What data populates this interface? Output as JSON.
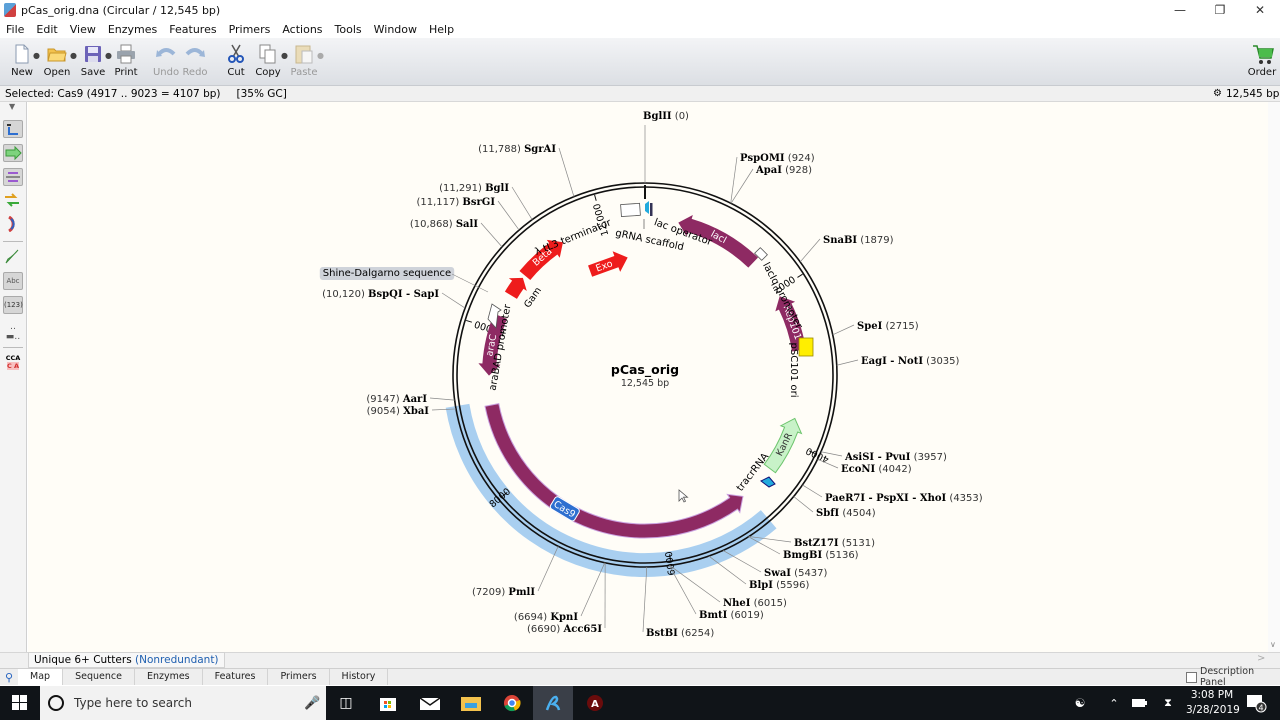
{
  "window": {
    "title": "pCas_orig.dna  (Circular / 12,545 bp)",
    "controls": [
      "minimize",
      "restore",
      "close"
    ]
  },
  "menu": [
    "File",
    "Edit",
    "View",
    "Enzymes",
    "Features",
    "Primers",
    "Actions",
    "Tools",
    "Window",
    "Help"
  ],
  "toolbar": {
    "buttons": [
      {
        "label": "New",
        "icon": "new-file-icon",
        "enabled": true,
        "dropdown": true
      },
      {
        "label": "Open",
        "icon": "folder-open-icon",
        "enabled": true,
        "dropdown": true
      },
      {
        "label": "Save",
        "icon": "save-icon",
        "enabled": true,
        "dropdown": true
      },
      {
        "label": "Print",
        "icon": "print-icon",
        "enabled": true,
        "dropdown": false
      },
      {
        "label": "Undo",
        "icon": "undo-icon",
        "enabled": false,
        "dropdown": false
      },
      {
        "label": "Redo",
        "icon": "redo-icon",
        "enabled": false,
        "dropdown": false
      },
      {
        "label": "Cut",
        "icon": "scissors-icon",
        "enabled": true,
        "dropdown": false
      },
      {
        "label": "Copy",
        "icon": "copy-icon",
        "enabled": true,
        "dropdown": true
      },
      {
        "label": "Paste",
        "icon": "paste-icon",
        "enabled": false,
        "dropdown": true
      }
    ],
    "order_label": "Order"
  },
  "status": {
    "selected": "Selected:  Cas9  (4917 .. 9023  =  4107 bp)",
    "gc": "[35% GC]",
    "length": "12,545 bp"
  },
  "left_tools": [
    "sequence-view-icon",
    "feature-arrow-icon",
    "enzyme-icon",
    "primer-icon",
    "arc-icon",
    "feather-icon",
    "text-abc-icon",
    "numbers-123-icon",
    "line-style-icon",
    "cca-sequence-icon"
  ],
  "left_tools_text": {
    "abc": "Abc",
    "num": "(123)",
    "cca1": "CCA",
    "cca2": "C  A"
  },
  "map": {
    "name": "pCas_orig",
    "length_bp": 12545,
    "length_label": "12,545 bp",
    "ticks": [
      {
        "bp": 2000,
        "label": "2000"
      },
      {
        "bp": 4000,
        "label": "4000"
      },
      {
        "bp": 6000,
        "label": "6000"
      },
      {
        "bp": 8000,
        "label": "8000"
      },
      {
        "bp": 10000,
        "label": "10,000"
      },
      {
        "bp": 12000,
        "label": "12,000"
      }
    ],
    "features": [
      {
        "name": "lacI",
        "start": 1530,
        "end": 430,
        "color": "#8e2a63",
        "direction": "reverse",
        "label_inside": true,
        "text_color": "#ffffff"
      },
      {
        "name": "Rep101",
        "start": 2820,
        "end": 2080,
        "color": "#8e2a63",
        "direction": "reverse",
        "label_inside": true,
        "text_color": "#ffffff"
      },
      {
        "name": "KanR",
        "start": 3700,
        "end": 4420,
        "color": "#c8f2c8",
        "direction": "reverse",
        "label_inside": true,
        "text_color": "#333333"
      },
      {
        "name": "Cas9",
        "start": 4917,
        "end": 9023,
        "color": "#8e2a63",
        "direction": "reverse",
        "label_inside": false,
        "badge": true
      },
      {
        "name": "araC",
        "start": 9400,
        "end": 10180,
        "color": "#8e2a63",
        "direction": "reverse",
        "label_inside": true,
        "text_color": "#ffffff"
      },
      {
        "name": "Gam",
        "start": 10480,
        "end": 10750,
        "color": "#ee1c1c",
        "direction": "forward",
        "label_inside": false
      },
      {
        "name": "Beta",
        "start": 10790,
        "end": 11440,
        "color": "#ee1c1c",
        "direction": "forward",
        "label_inside": true,
        "text_color": "#ffffff"
      }
    ],
    "exo": {
      "name": "Exo",
      "color": "#ee1c1c"
    },
    "small_features": [
      {
        "name": "λ tL3 terminator",
        "kind": "terminator"
      },
      {
        "name": "gRNA scaffold",
        "kind": "misc"
      },
      {
        "name": "lac operator",
        "kind": "protein-bind"
      },
      {
        "name": "lacIq promoter",
        "kind": "promoter"
      },
      {
        "name": "pSC101 ori",
        "kind": "rep-origin",
        "color": "#ffee00"
      },
      {
        "name": "tracrRNA",
        "kind": "ncRNA",
        "color": "#22aadd"
      },
      {
        "name": "araBAD promoter",
        "kind": "promoter"
      },
      {
        "name": "Shine-Dalgarno sequence",
        "kind": "rbs",
        "highlighted": true
      }
    ],
    "selection": {
      "start": 4917,
      "end": 9023,
      "color": "#a9cff0"
    },
    "enzymes": [
      {
        "name": "BglII",
        "pos": "0",
        "bp": 0
      },
      {
        "name": "PspOMI",
        "pos": "924",
        "bp": 924
      },
      {
        "name": "ApaI",
        "pos": "928",
        "bp": 928
      },
      {
        "name": "SnaBI",
        "pos": "1879",
        "bp": 1879
      },
      {
        "name": "SpeI",
        "pos": "2715",
        "bp": 2715
      },
      {
        "name": "EagI - NotI",
        "pos": "3035",
        "bp": 3035
      },
      {
        "name": "AsiSI - PvuI",
        "pos": "3957",
        "bp": 3957
      },
      {
        "name": "EcoNI",
        "pos": "4042",
        "bp": 4042
      },
      {
        "name": "PaeR7I - PspXI - XhoI",
        "pos": "4353",
        "bp": 4353
      },
      {
        "name": "SbfI",
        "pos": "4504",
        "bp": 4504
      },
      {
        "name": "BstZ17I",
        "pos": "5131",
        "bp": 5131
      },
      {
        "name": "BmgBI",
        "pos": "5136",
        "bp": 5136
      },
      {
        "name": "SwaI",
        "pos": "5437",
        "bp": 5437
      },
      {
        "name": "BlpI",
        "pos": "5596",
        "bp": 5596
      },
      {
        "name": "NheI",
        "pos": "6015",
        "bp": 6015
      },
      {
        "name": "BmtI",
        "pos": "6019",
        "bp": 6019
      },
      {
        "name": "BstBI",
        "pos": "6254",
        "bp": 6254
      },
      {
        "name": "Acc65I",
        "pos": "6690",
        "bp": 6690
      },
      {
        "name": "KpnI",
        "pos": "6694",
        "bp": 6694
      },
      {
        "name": "PmlI",
        "pos": "7209",
        "bp": 7209
      },
      {
        "name": "XbaI",
        "pos": "9054",
        "bp": 9054
      },
      {
        "name": "AarI",
        "pos": "9147",
        "bp": 9147
      },
      {
        "name": "BspQI - SapI",
        "pos": "10,120",
        "bp": 10120
      },
      {
        "name": "SalI",
        "pos": "10,868",
        "bp": 10868
      },
      {
        "name": "BsrGI",
        "pos": "11,117",
        "bp": 11117
      },
      {
        "name": "BglI",
        "pos": "11,291",
        "bp": 11291
      },
      {
        "name": "SgrAI",
        "pos": "11,788",
        "bp": 11788
      }
    ]
  },
  "enzyme_set": {
    "label": "Unique 6+ Cutters",
    "qualifier": "(Nonredundant)"
  },
  "view_tabs": [
    {
      "label": "Map",
      "active": true
    },
    {
      "label": "Sequence",
      "active": false
    },
    {
      "label": "Enzymes",
      "active": false
    },
    {
      "label": "Features",
      "active": false
    },
    {
      "label": "Primers",
      "active": false
    },
    {
      "label": "History",
      "active": false
    }
  ],
  "description_panel": {
    "label": "Description Panel",
    "checked": false
  },
  "taskbar": {
    "search_placeholder": "Type here to search",
    "time": "3:08 PM",
    "date": "3/28/2019",
    "notifications": "4"
  }
}
